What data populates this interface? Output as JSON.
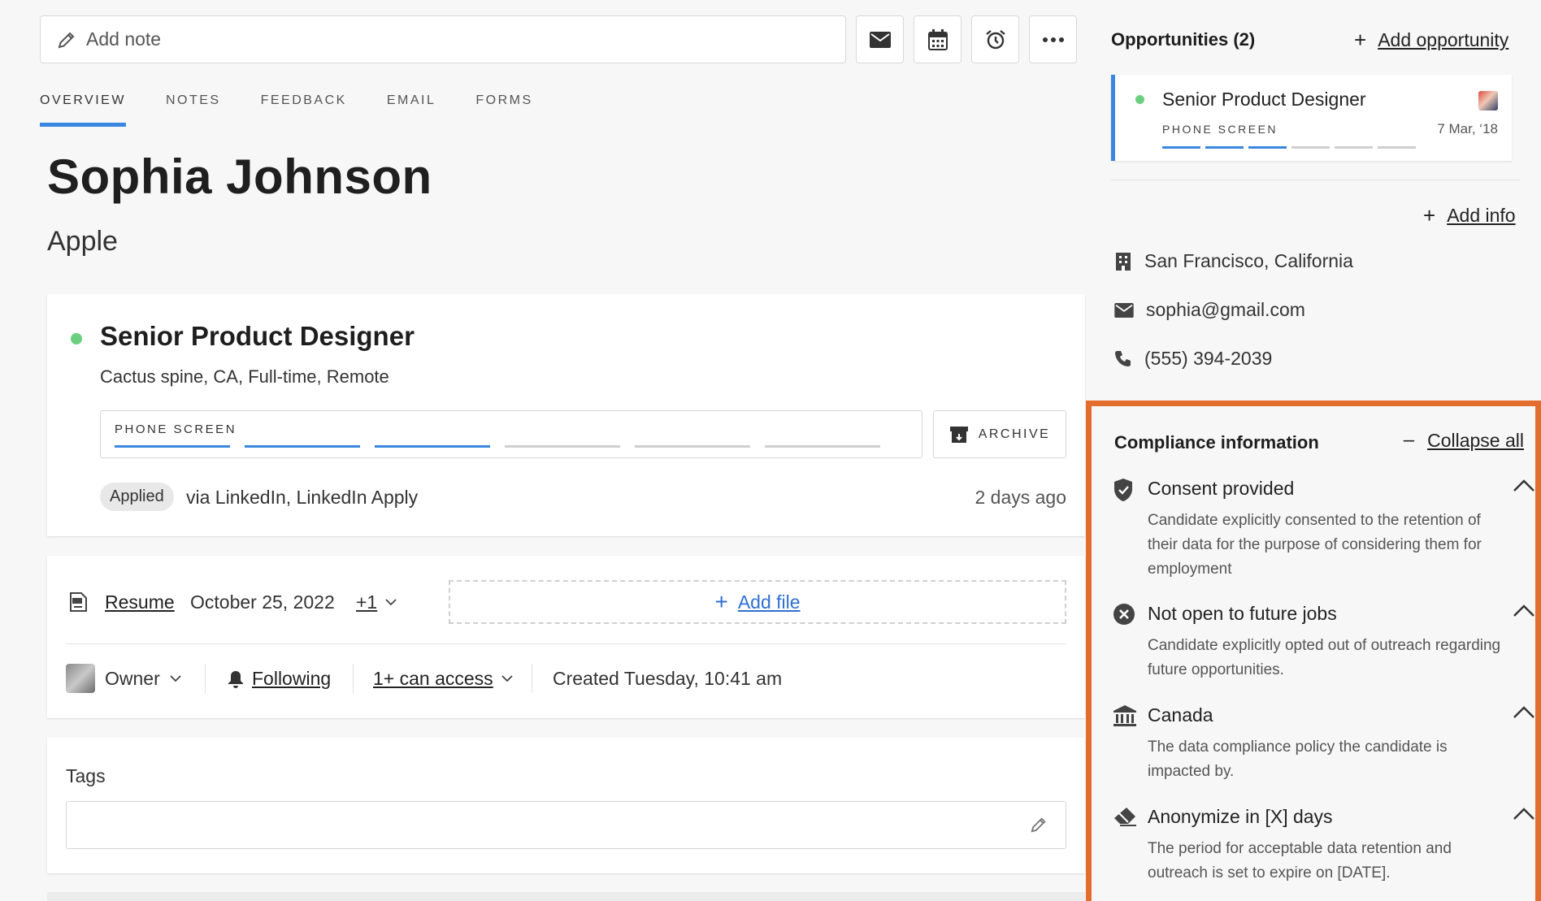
{
  "toolbar": {
    "note_placeholder": "Add note",
    "buttons": [
      "email",
      "calendar",
      "alarm",
      "more"
    ]
  },
  "tabs": [
    {
      "label": "OVERVIEW",
      "active": true
    },
    {
      "label": "NOTES",
      "active": false
    },
    {
      "label": "FEEDBACK",
      "active": false
    },
    {
      "label": "EMAIL",
      "active": false
    },
    {
      "label": "FORMS",
      "active": false
    }
  ],
  "candidate": {
    "name": "Sophia Johnson",
    "company": "Apple"
  },
  "opportunity_card": {
    "title": "Senior Product Designer",
    "meta": "Cactus spine, CA, Full-time, Remote",
    "stage_label": "PHONE SCREEN",
    "stage_progress": "3 of 6",
    "archive_label": "ARCHIVE",
    "source_pill": "Applied",
    "source_text": "via LinkedIn, LinkedIn Apply",
    "time_ago": "2 days ago"
  },
  "files": {
    "resume_label": "Resume",
    "resume_date": "October 25, 2022",
    "more_count": "+1",
    "add_file_label": "Add file"
  },
  "meta_row": {
    "owner_label": "Owner",
    "following_label": "Following",
    "access_label": "1+ can access",
    "created_text": "Created Tuesday, 10:41 am"
  },
  "tags": {
    "label": "Tags"
  },
  "sidebar": {
    "opportunities_heading": "Opportunities (2)",
    "add_opportunity_label": "Add opportunity",
    "opp": {
      "title": "Senior Product Designer",
      "stage": "PHONE SCREEN",
      "date": "7 Mar, ‘18",
      "stage_progress": "3 of 6"
    },
    "add_info_label": "Add info",
    "contacts": {
      "location": "San Francisco, California",
      "email": "sophia@gmail.com",
      "phone": "(555) 394-2039"
    }
  },
  "compliance": {
    "heading": "Compliance information",
    "collapse_label": "Collapse all",
    "items": [
      {
        "icon": "shield-check-icon",
        "title": "Consent provided",
        "desc": "Candidate explicitly consented to the retention of their data for the purpose of considering them for employment"
      },
      {
        "icon": "x-circle-icon",
        "title": "Not open to future jobs",
        "desc": "Candidate explicitly opted out of outreach regarding future opportunities."
      },
      {
        "icon": "bank-icon",
        "title": "Canada",
        "desc": "The data compliance policy the candidate is impacted by."
      },
      {
        "icon": "eraser-icon",
        "title": "Anonymize in [X] days",
        "desc": "The period for acceptable data retention and outreach is set to expire on [DATE]."
      }
    ]
  },
  "colors": {
    "accent": "#3a87e0",
    "status_green": "#6ccf7f",
    "highlight_orange": "#e36d2c"
  }
}
